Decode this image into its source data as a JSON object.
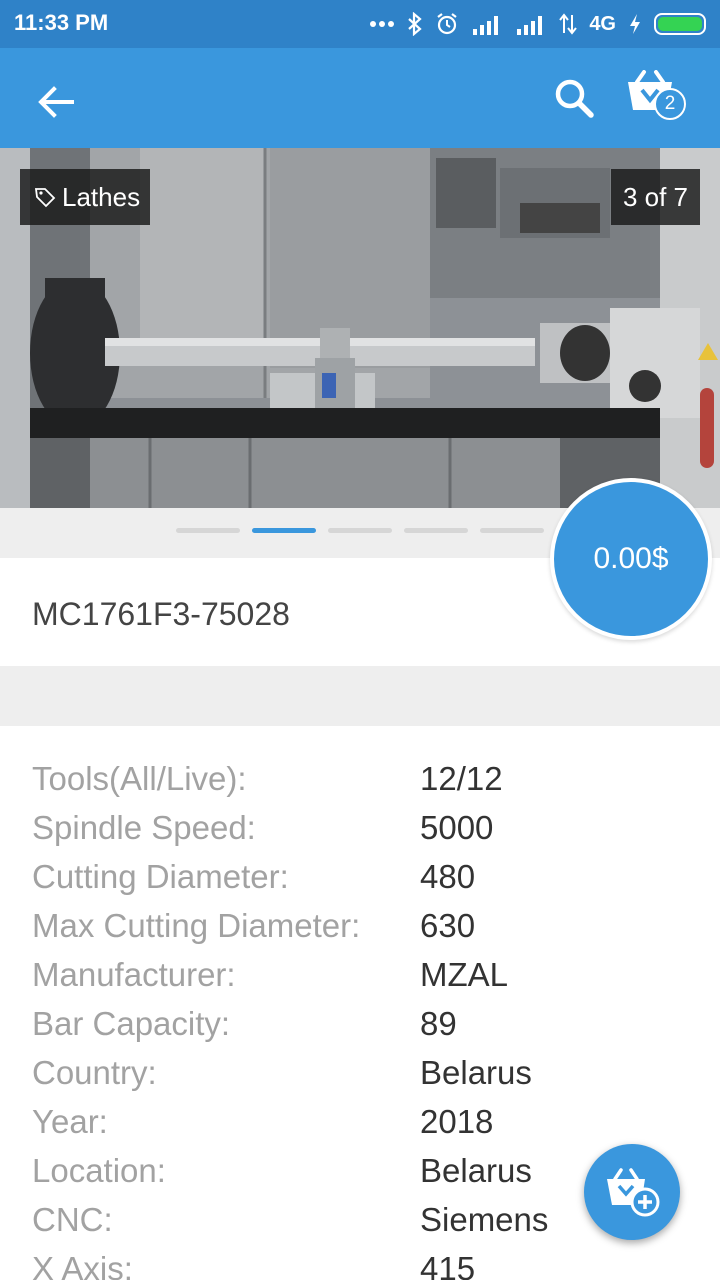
{
  "status_bar": {
    "time": "11:33 PM",
    "network": "4G",
    "icons": [
      "more-dots-icon",
      "bluetooth-icon",
      "alarm-icon",
      "signal-icon",
      "signal-icon",
      "data-transfer-icon",
      "charging-icon",
      "battery-icon"
    ]
  },
  "app_bar": {
    "cart_count": "2"
  },
  "gallery": {
    "category": "Lathes",
    "counter": "3 of 7",
    "page_count": 5,
    "active_index": 1
  },
  "product": {
    "code": "MC1761F3-75028",
    "price": "0.00$"
  },
  "specs": [
    {
      "label": "Tools(All/Live):",
      "value": "12/12"
    },
    {
      "label": "Spindle Speed:",
      "value": "5000"
    },
    {
      "label": "Cutting Diameter:",
      "value": "480"
    },
    {
      "label": "Max Cutting Diameter:",
      "value": "630"
    },
    {
      "label": "Manufacturer:",
      "value": "MZAL"
    },
    {
      "label": "Bar Capacity:",
      "value": "89"
    },
    {
      "label": "Country:",
      "value": "Belarus"
    },
    {
      "label": "Year:",
      "value": "2018"
    },
    {
      "label": "Location:",
      "value": "Belarus"
    },
    {
      "label": "CNC:",
      "value": "Siemens"
    },
    {
      "label": "X Axis:",
      "value": "415"
    }
  ],
  "colors": {
    "status_bar": "#2f82c8",
    "app_bar": "#3a97dd",
    "accent": "#3a97dd",
    "battery": "#34d353"
  }
}
